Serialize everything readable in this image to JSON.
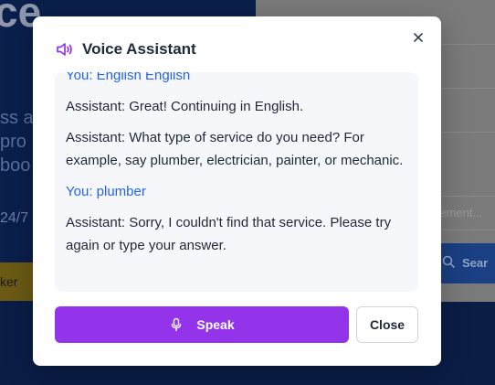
{
  "background": {
    "heading_fragment": "ce",
    "description_lines": [
      "ss al",
      "pro",
      "boo"
    ],
    "hours_fragment": "24/7",
    "cta_fragment": "ker",
    "search_placeholder": "rement...",
    "search_button_label": "Sear"
  },
  "modal": {
    "title": "Voice Assistant",
    "icon": "speaker-icon",
    "accent_color": "#9333ea",
    "transcript": [
      {
        "role": "user",
        "text": "You: English English"
      },
      {
        "role": "assistant",
        "text": "Assistant: Great! Continuing in English."
      },
      {
        "role": "assistant",
        "text": "Assistant: What type of service do you need? For example, say plumber, electrician, painter, or mechanic."
      },
      {
        "role": "user",
        "text": "You: plumber"
      },
      {
        "role": "assistant",
        "text": "Assistant: Sorry, I couldn't find that service. Please try again or type your answer."
      }
    ],
    "speak_label": "Speak",
    "close_label": "Close"
  }
}
